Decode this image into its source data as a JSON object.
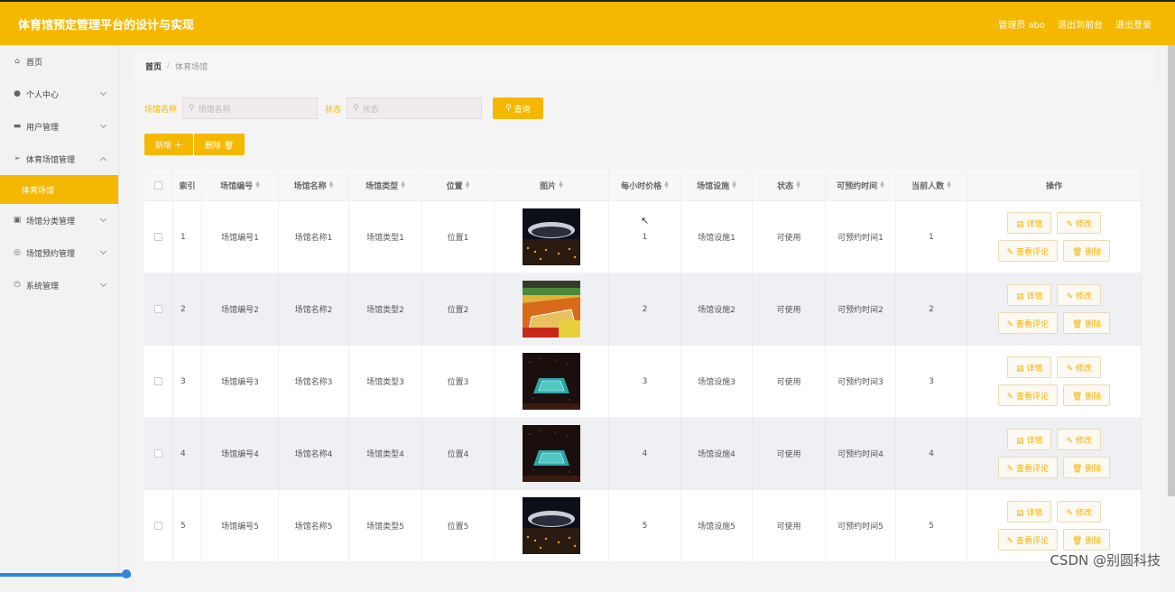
{
  "header": {
    "title": "体育馆预定管理平台的设计与实现",
    "user": "管理员 abo",
    "to_front": "退出到前台",
    "logout": "退出登录"
  },
  "sidebar": {
    "items": [
      {
        "label": "首页",
        "icon": "home-icon",
        "glyph": "⌂",
        "chevron": ""
      },
      {
        "label": "个人中心",
        "icon": "user-icon",
        "glyph": "●",
        "chevron": "down"
      },
      {
        "label": "用户管理",
        "icon": "chat-icon",
        "glyph": "▬",
        "chevron": "down"
      },
      {
        "label": "体育场馆管理",
        "icon": "send-icon",
        "glyph": "➢",
        "chevron": "up"
      },
      {
        "label": "场馆分类管理",
        "icon": "picture-icon",
        "glyph": "▣",
        "chevron": "down"
      },
      {
        "label": "场馆预约管理",
        "icon": "globe-icon",
        "glyph": "◎",
        "chevron": "down"
      },
      {
        "label": "系统管理",
        "icon": "power-icon",
        "glyph": "⏻",
        "chevron": "down"
      }
    ],
    "active_sub": "体育场馆"
  },
  "breadcrumb": {
    "home": "首页",
    "current": "体育场馆"
  },
  "search": {
    "name_label": "场馆名称",
    "name_placeholder": "场馆名称",
    "status_label": "状态",
    "status_placeholder": "状态",
    "query": "查询"
  },
  "toolbar": {
    "add": "新增 ＋",
    "delete": "删除 🗑"
  },
  "table": {
    "headers": [
      "索引",
      "场馆编号",
      "场馆名称",
      "场馆类型",
      "位置",
      "图片",
      "每小时价格",
      "场馆设施",
      "状态",
      "可预约时间",
      "当前人数",
      "操作"
    ],
    "rows": [
      {
        "index": "1",
        "code": "场馆编号1",
        "name": "场馆名称1",
        "type": "场馆类型1",
        "loc": "位置1",
        "price": "1",
        "facility": "场馆设施1",
        "status": "可使用",
        "time": "可预约时间1",
        "people": "1",
        "img": "night-stadium"
      },
      {
        "index": "2",
        "code": "场馆编号2",
        "name": "场馆名称2",
        "type": "场馆类型2",
        "loc": "位置2",
        "price": "2",
        "facility": "场馆设施2",
        "status": "可使用",
        "time": "可预约时间2",
        "people": "2",
        "img": "indoor-court"
      },
      {
        "index": "3",
        "code": "场馆编号3",
        "name": "场馆名称3",
        "type": "场馆类型3",
        "loc": "位置3",
        "price": "3",
        "facility": "场馆设施3",
        "status": "可使用",
        "time": "可预约时间3",
        "people": "3",
        "img": "arena"
      },
      {
        "index": "4",
        "code": "场馆编号4",
        "name": "场馆名称4",
        "type": "场馆类型4",
        "loc": "位置4",
        "price": "4",
        "facility": "场馆设施4",
        "status": "可使用",
        "time": "可预约时间4",
        "people": "4",
        "img": "arena"
      },
      {
        "index": "5",
        "code": "场馆编号5",
        "name": "场馆名称5",
        "type": "场馆类型5",
        "loc": "位置5",
        "price": "5",
        "facility": "场馆设施5",
        "status": "可使用",
        "time": "可预约时间5",
        "people": "5",
        "img": "night-stadium"
      }
    ],
    "ops": {
      "detail": "▤ 详情",
      "edit": "✎ 修改",
      "review": "✎ 查看评论",
      "remove": "🗑 删除"
    }
  },
  "watermark": "CSDN @别圆科技",
  "colors": {
    "accent": "#f5b800"
  }
}
